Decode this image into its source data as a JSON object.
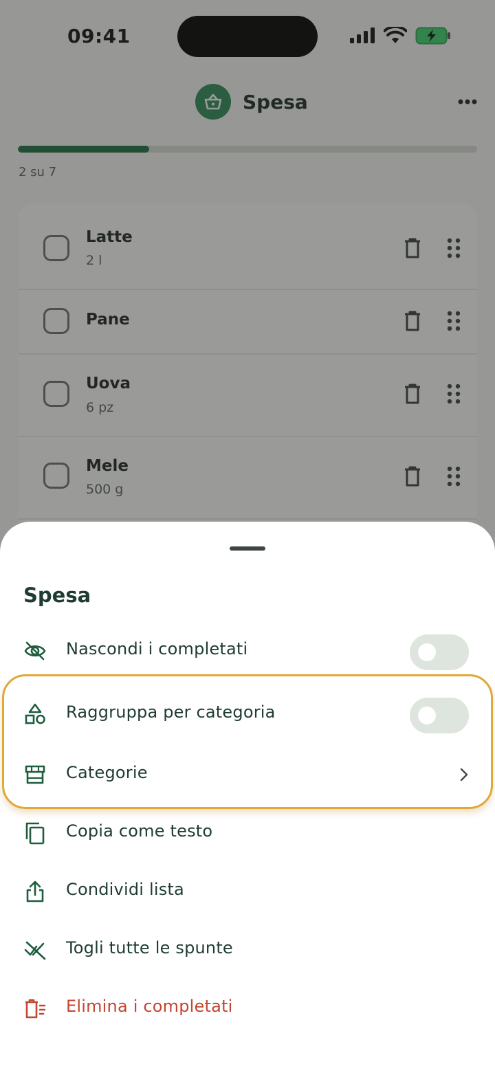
{
  "status_bar": {
    "time": "09:41"
  },
  "header": {
    "title": "Spesa",
    "logo_icon": "basket-icon",
    "more_icon": "more-horizontal-icon"
  },
  "progress": {
    "text": "2 su 7",
    "done": 2,
    "total": 7
  },
  "items": [
    {
      "name": "Latte",
      "qty": "2 l"
    },
    {
      "name": "Pane",
      "qty": ""
    },
    {
      "name": "Uova",
      "qty": "6 pz"
    },
    {
      "name": "Mele",
      "qty": "500 g"
    }
  ],
  "sheet": {
    "title": "Spesa",
    "options": {
      "hide_completed": {
        "label": "Nascondi i completati",
        "icon": "eye-off-icon",
        "enabled": false
      },
      "group_by_category": {
        "label": "Raggruppa per categoria",
        "icon": "shapes-icon",
        "enabled": false
      },
      "categories": {
        "label": "Categorie",
        "icon": "store-icon"
      },
      "copy_text": {
        "label": "Copia come testo",
        "icon": "copy-icon"
      },
      "share_list": {
        "label": "Condividi lista",
        "icon": "share-icon"
      },
      "uncheck_all": {
        "label": "Togli tutte le spunte",
        "icon": "check-off-icon"
      },
      "delete_completed": {
        "label": "Elimina i completati",
        "icon": "delete-list-icon"
      }
    }
  },
  "colors": {
    "accent": "#1f6e45",
    "highlight": "#e1a836",
    "danger": "#c24630",
    "text": "#1f3c30"
  }
}
